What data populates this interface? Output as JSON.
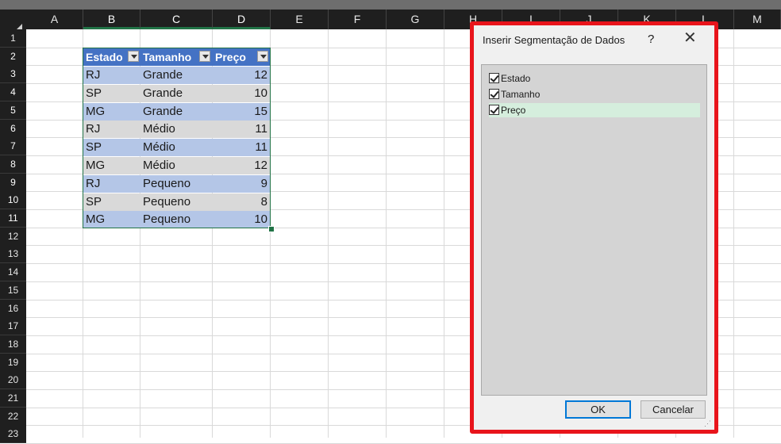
{
  "spreadsheet": {
    "columns": [
      "A",
      "B",
      "C",
      "D",
      "E",
      "F",
      "G",
      "H",
      "I",
      "J",
      "K",
      "L",
      "M"
    ],
    "rows": [
      "1",
      "2",
      "3",
      "4",
      "5",
      "6",
      "7",
      "8",
      "9",
      "10",
      "11",
      "12",
      "13",
      "14",
      "15",
      "16",
      "17",
      "18",
      "19",
      "20",
      "21",
      "22",
      "23"
    ]
  },
  "table": {
    "headers": [
      "Estado",
      "Tamanho",
      "Preço"
    ],
    "rows": [
      [
        "RJ",
        "Grande",
        "12"
      ],
      [
        "SP",
        "Grande",
        "10"
      ],
      [
        "MG",
        "Grande",
        "15"
      ],
      [
        "RJ",
        "Médio",
        "11"
      ],
      [
        "SP",
        "Médio",
        "11"
      ],
      [
        "MG",
        "Médio",
        "12"
      ],
      [
        "RJ",
        "Pequeno",
        "9"
      ],
      [
        "SP",
        "Pequeno",
        "8"
      ],
      [
        "MG",
        "Pequeno",
        "10"
      ]
    ]
  },
  "dialog": {
    "title": "Inserir Segmentação de Dados",
    "help": "?",
    "close": "✕",
    "fields": [
      {
        "label": "Estado",
        "checked": true
      },
      {
        "label": "Tamanho",
        "checked": true
      },
      {
        "label": "Preço",
        "checked": true
      }
    ],
    "ok_label": "OK",
    "cancel_label": "Cancelar"
  },
  "colors": {
    "table_header": "#4472c4",
    "table_band": "#b4c6e7",
    "highlight_frame": "#e8141b",
    "selected_row": "#d5eedd"
  }
}
